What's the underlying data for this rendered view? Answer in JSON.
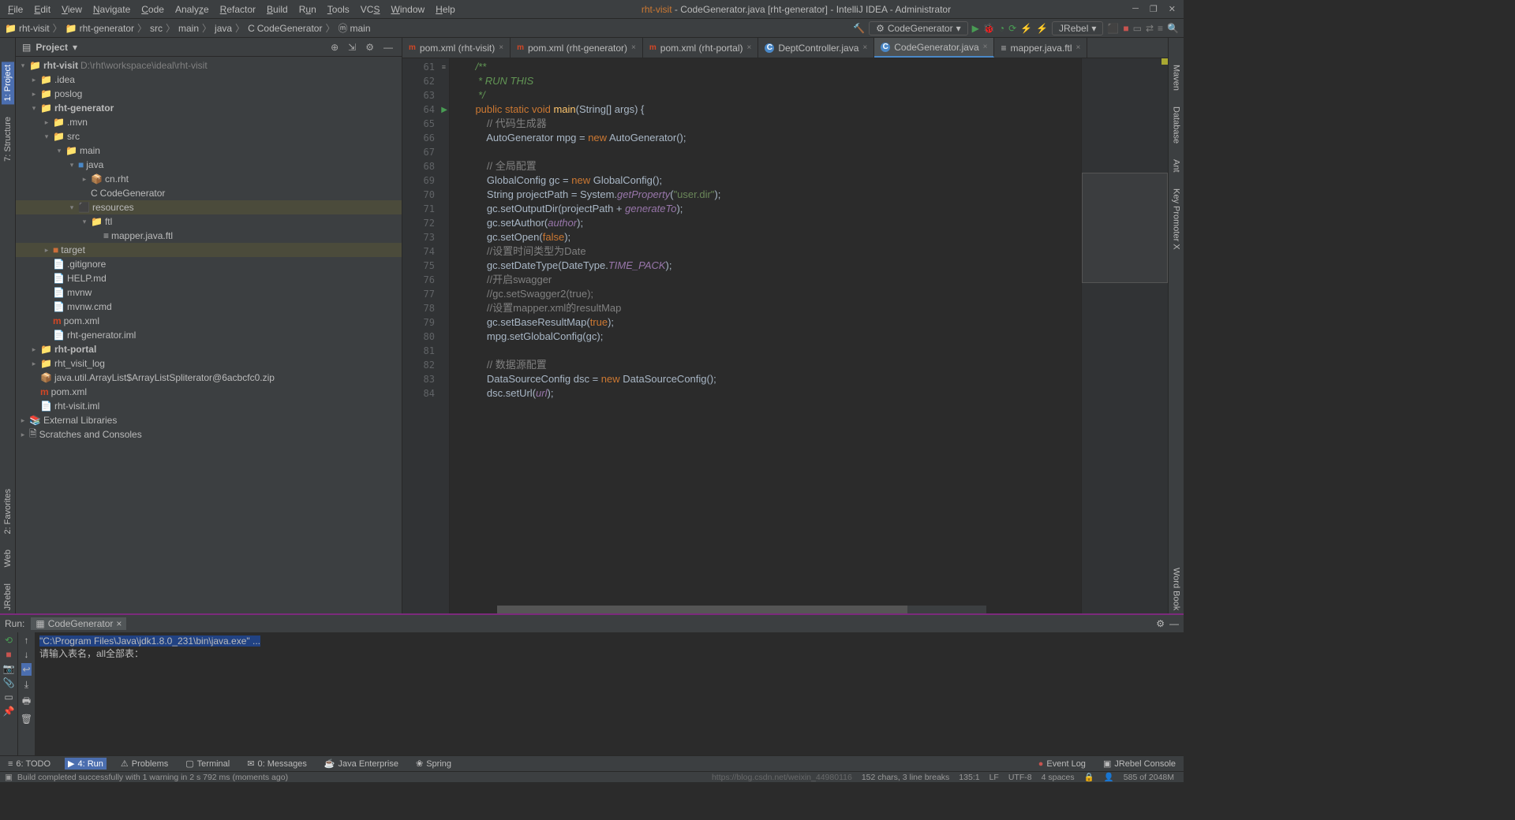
{
  "menus": [
    "File",
    "Edit",
    "View",
    "Navigate",
    "Code",
    "Analyze",
    "Refactor",
    "Build",
    "Run",
    "Tools",
    "VCS",
    "Window",
    "Help"
  ],
  "title": {
    "project": "rht-visit",
    "file": "CodeGenerator.java",
    "module": "[rht-generator]",
    "app": "IntelliJ IDEA",
    "suffix": "Administrator"
  },
  "breadcrumb": [
    "rht-visit",
    "rht-generator",
    "src",
    "main",
    "java",
    "CodeGenerator",
    "main"
  ],
  "run_config": "CodeGenerator",
  "jrebel": "JRebel",
  "project_panel_title": "Project",
  "tree": {
    "root": {
      "name": "rht-visit",
      "path": "D:\\rht\\workspace\\ideal\\rht-visit"
    },
    "idea": ".idea",
    "poslog": "poslog",
    "rhtgen": "rht-generator",
    "mvn": ".mvn",
    "src": "src",
    "main_dir": "main",
    "java": "java",
    "cnrht": "cn.rht",
    "codegen": "CodeGenerator",
    "resources": "resources",
    "ftl": "ftl",
    "mapper": "mapper.java.ftl",
    "target": "target",
    "gitignore": ".gitignore",
    "help": "HELP.md",
    "mvnw": "mvnw",
    "mvnwcmd": "mvnw.cmd",
    "pomxml": "pom.xml",
    "iml": "rht-generator.iml",
    "rhtportal": "rht-portal",
    "rhtvisitlog": "rht_visit_log",
    "zip": "java.util.ArrayList$ArrayListSpliterator@6acbcfc0.zip",
    "pomroot": "pom.xml",
    "imlroot": "rht-visit.iml",
    "extlibs": "External Libraries",
    "scratches": "Scratches and Consoles"
  },
  "tabs": [
    {
      "label": "pom.xml (rht-visit)",
      "type": "m"
    },
    {
      "label": "pom.xml (rht-generator)",
      "type": "m"
    },
    {
      "label": "pom.xml (rht-portal)",
      "type": "m"
    },
    {
      "label": "DeptController.java",
      "type": "c"
    },
    {
      "label": "CodeGenerator.java",
      "type": "c",
      "active": true
    },
    {
      "label": "mapper.java.ftl",
      "type": "f"
    }
  ],
  "lines": [
    61,
    62,
    63,
    64,
    65,
    66,
    67,
    68,
    69,
    70,
    71,
    72,
    73,
    74,
    75,
    76,
    77,
    78,
    79,
    80,
    81,
    82,
    83,
    84
  ],
  "code": [
    {
      "t": "doc",
      "s": "    /**"
    },
    {
      "t": "doc",
      "s": "     * RUN THIS"
    },
    {
      "t": "doc",
      "s": "     */"
    },
    {
      "t": "main",
      "s": ""
    },
    {
      "t": "cmt",
      "s": "        // 代码生成器"
    },
    {
      "t": "autogen",
      "s": ""
    },
    {
      "t": "blank",
      "s": ""
    },
    {
      "t": "cmt",
      "s": "        // 全局配置"
    },
    {
      "t": "globalconf",
      "s": ""
    },
    {
      "t": "projpath",
      "s": ""
    },
    {
      "t": "outputdir",
      "s": ""
    },
    {
      "t": "author",
      "s": ""
    },
    {
      "t": "open",
      "s": ""
    },
    {
      "t": "cmt",
      "s": "        //设置时间类型为Date"
    },
    {
      "t": "datetype",
      "s": ""
    },
    {
      "t": "cmt",
      "s": "        //开启swagger"
    },
    {
      "t": "cmt",
      "s": "        //gc.setSwagger2(true);"
    },
    {
      "t": "cmt",
      "s": "        //设置mapper.xml的resultMap"
    },
    {
      "t": "basemap",
      "s": ""
    },
    {
      "t": "setglobal",
      "s": ""
    },
    {
      "t": "blank",
      "s": ""
    },
    {
      "t": "cmt",
      "s": "        // 数据源配置"
    },
    {
      "t": "dsc",
      "s": ""
    },
    {
      "t": "seturl",
      "s": ""
    }
  ],
  "run_label": "Run:",
  "run_tab": "CodeGenerator",
  "run_cmd": "\"C:\\Program Files\\Java\\jdk1.8.0_231\\bin\\java.exe\" ...",
  "run_prompt": "请输入表名，all全部表：",
  "bottom_tabs": {
    "todo": "6: TODO",
    "run": "4: Run",
    "problems": "Problems",
    "terminal": "Terminal",
    "messages": "0: Messages",
    "je": "Java Enterprise",
    "spring": "Spring",
    "eventlog": "Event Log",
    "jrebel": "JRebel Console"
  },
  "status": {
    "build": "Build completed successfully with 1 warning in 2 s 792 ms (moments ago)",
    "chars": "152 chars, 3 line breaks",
    "pos": "135:1",
    "lf": "LF",
    "enc": "UTF-8",
    "spaces": "4 spaces",
    "mem": "585 of 2048M",
    "watermark": "https://blog.csdn.net/weixin_44980116"
  },
  "left_strip": [
    "1: Project",
    "2: Favorites",
    "7: Structure",
    "Web",
    "JRebel"
  ],
  "right_strip": [
    "Maven",
    "Database",
    "Ant",
    "Key Promoter X",
    "Word Book"
  ]
}
